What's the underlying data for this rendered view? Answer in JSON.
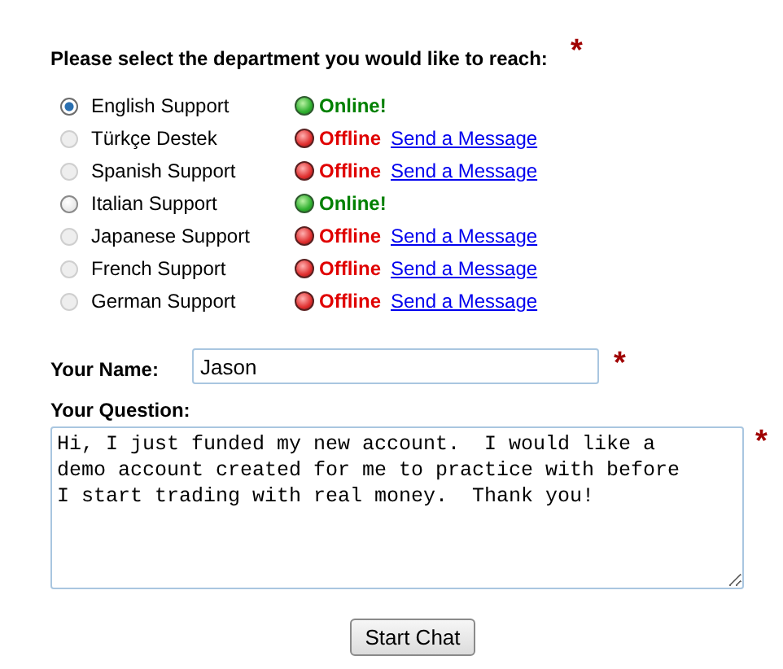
{
  "department_prompt": {
    "label": "Please select the department you would like to reach:",
    "required_mark": "*"
  },
  "departments": [
    {
      "label": "English Support",
      "selected": true,
      "disabled": false,
      "kind": "online",
      "status_text": "Online!"
    },
    {
      "label": "Türkçe Destek",
      "selected": false,
      "disabled": true,
      "kind": "offline",
      "status_text": "Offline",
      "link": "Send a Message"
    },
    {
      "label": "Spanish Support",
      "selected": false,
      "disabled": true,
      "kind": "offline",
      "status_text": "Offline",
      "link": "Send a Message"
    },
    {
      "label": "Italian Support",
      "selected": false,
      "disabled": false,
      "kind": "online",
      "status_text": "Online!"
    },
    {
      "label": "Japanese Support",
      "selected": false,
      "disabled": true,
      "kind": "offline",
      "status_text": "Offline",
      "link": "Send a Message"
    },
    {
      "label": "French Support",
      "selected": false,
      "disabled": true,
      "kind": "offline",
      "status_text": "Offline",
      "link": "Send a Message"
    },
    {
      "label": "German Support",
      "selected": false,
      "disabled": true,
      "kind": "offline",
      "status_text": "Offline",
      "link": "Send a Message"
    }
  ],
  "name_field": {
    "label": "Your Name:",
    "value": "Jason",
    "required_mark": "*"
  },
  "question_field": {
    "label": "Your Question:",
    "value": "Hi, I just funded my new account.  I would like a\ndemo account created for me to practice with before\nI start trading with real money.  Thank you!",
    "required_mark": "*"
  },
  "submit_button": "Start Chat"
}
